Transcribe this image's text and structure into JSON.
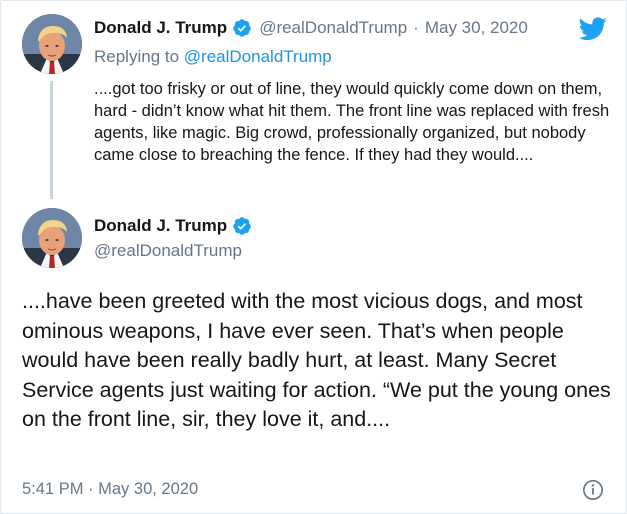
{
  "colors": {
    "twitter_blue": "#1da1f2",
    "link_blue": "#1b95e0",
    "text_primary": "#14171a",
    "text_secondary": "#657786",
    "thread_line": "#ccd6dd"
  },
  "parent_tweet": {
    "author_name": "Donald J. Trump",
    "handle": "@realDonaldTrump",
    "separator": "·",
    "date": "May 30, 2020",
    "replying_prefix": "Replying to",
    "replying_to": "@realDonaldTrump",
    "text": "....got too frisky or out of line, they would quickly come down on them, hard - didn’t know what hit them. The front line was replaced with fresh agents, like magic. Big crowd, professionally organized, but nobody came close to breaching the fence. If they had they would....",
    "avatar_icon": "profile-photo",
    "verified_icon": "verified-badge-icon"
  },
  "brand": {
    "logo_icon": "twitter-bird-icon"
  },
  "main_tweet": {
    "author_name": "Donald J. Trump",
    "handle": "@realDonaldTrump",
    "text": "....have been greeted with the most vicious dogs, and most ominous weapons, I have ever seen. That’s when people would have been really badly hurt, at least. Many Secret Service agents just waiting for action. “We put the young ones on the front line, sir, they love it, and....",
    "time": "5:41 PM",
    "separator": "·",
    "date": "May 30, 2020",
    "info_icon": "info-icon"
  }
}
